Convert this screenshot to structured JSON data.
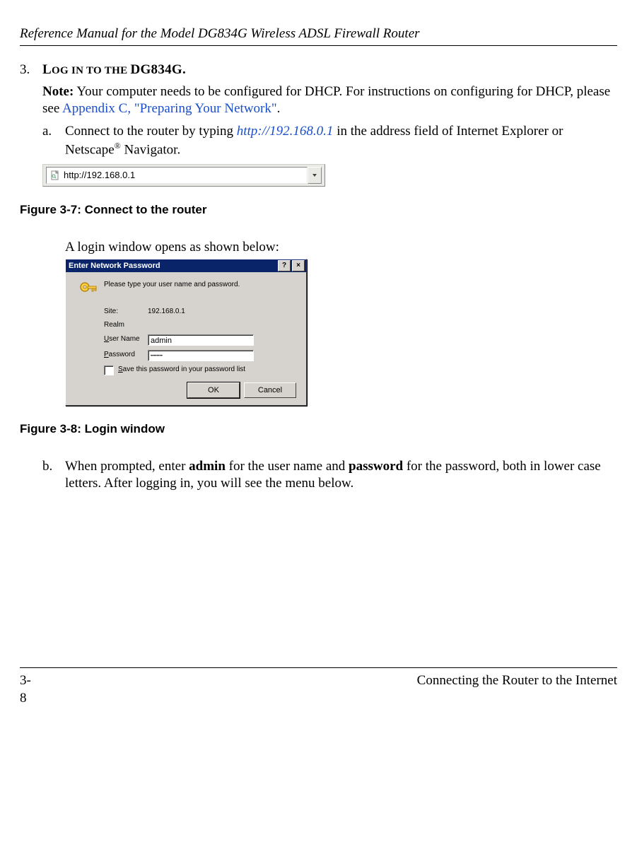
{
  "header": {
    "title": "Reference Manual for the Model DG834G Wireless ADSL Firewall Router"
  },
  "step": {
    "number": "3.",
    "heading_upper_1": "L",
    "heading_lower_1": "OG",
    "heading_upper_2": " IN TO THE ",
    "heading_mixed": "DG834G."
  },
  "note": {
    "label": "Note:",
    "text_before_link": " Your computer needs to be configured for DHCP. For instructions on configuring for DHCP, please see ",
    "link": "Appendix C, \"Preparing Your Network\"",
    "text_after_link": "."
  },
  "sub_a": {
    "letter": "a.",
    "text_before_link": "Connect to the router by typing ",
    "link": "http://192.168.0.1",
    "text_after_link": " in the address field of Internet Explorer or Netscape",
    "reg": "®",
    "tail": " Navigator."
  },
  "addrbar": {
    "value": "http://192.168.0.1"
  },
  "fig1": "Figure 3-7:  Connect to the router",
  "intro2": "A login window opens as shown below:",
  "dialog": {
    "title": "Enter Network Password",
    "help_btn": "?",
    "close_btn": "×",
    "prompt": "Please type your user name and password.",
    "site_label": "Site:",
    "site_value": "192.168.0.1",
    "realm_label": "Realm",
    "user_label": "User Name",
    "user_value": "admin",
    "pass_label": "Password",
    "pass_value": "••••••••",
    "save_label": "Save this password in your password list",
    "ok": "OK",
    "cancel": "Cancel"
  },
  "fig2": "Figure 3-8:  Login window",
  "sub_b": {
    "letter": "b.",
    "t1": "When prompted, enter ",
    "b1": "admin",
    "t2": " for the user name and ",
    "b2": "password",
    "t3": " for the password, both in lower case letters. After logging in, you will see the menu below."
  },
  "footer": {
    "left": "3-8",
    "right": "Connecting the Router to the Internet"
  }
}
